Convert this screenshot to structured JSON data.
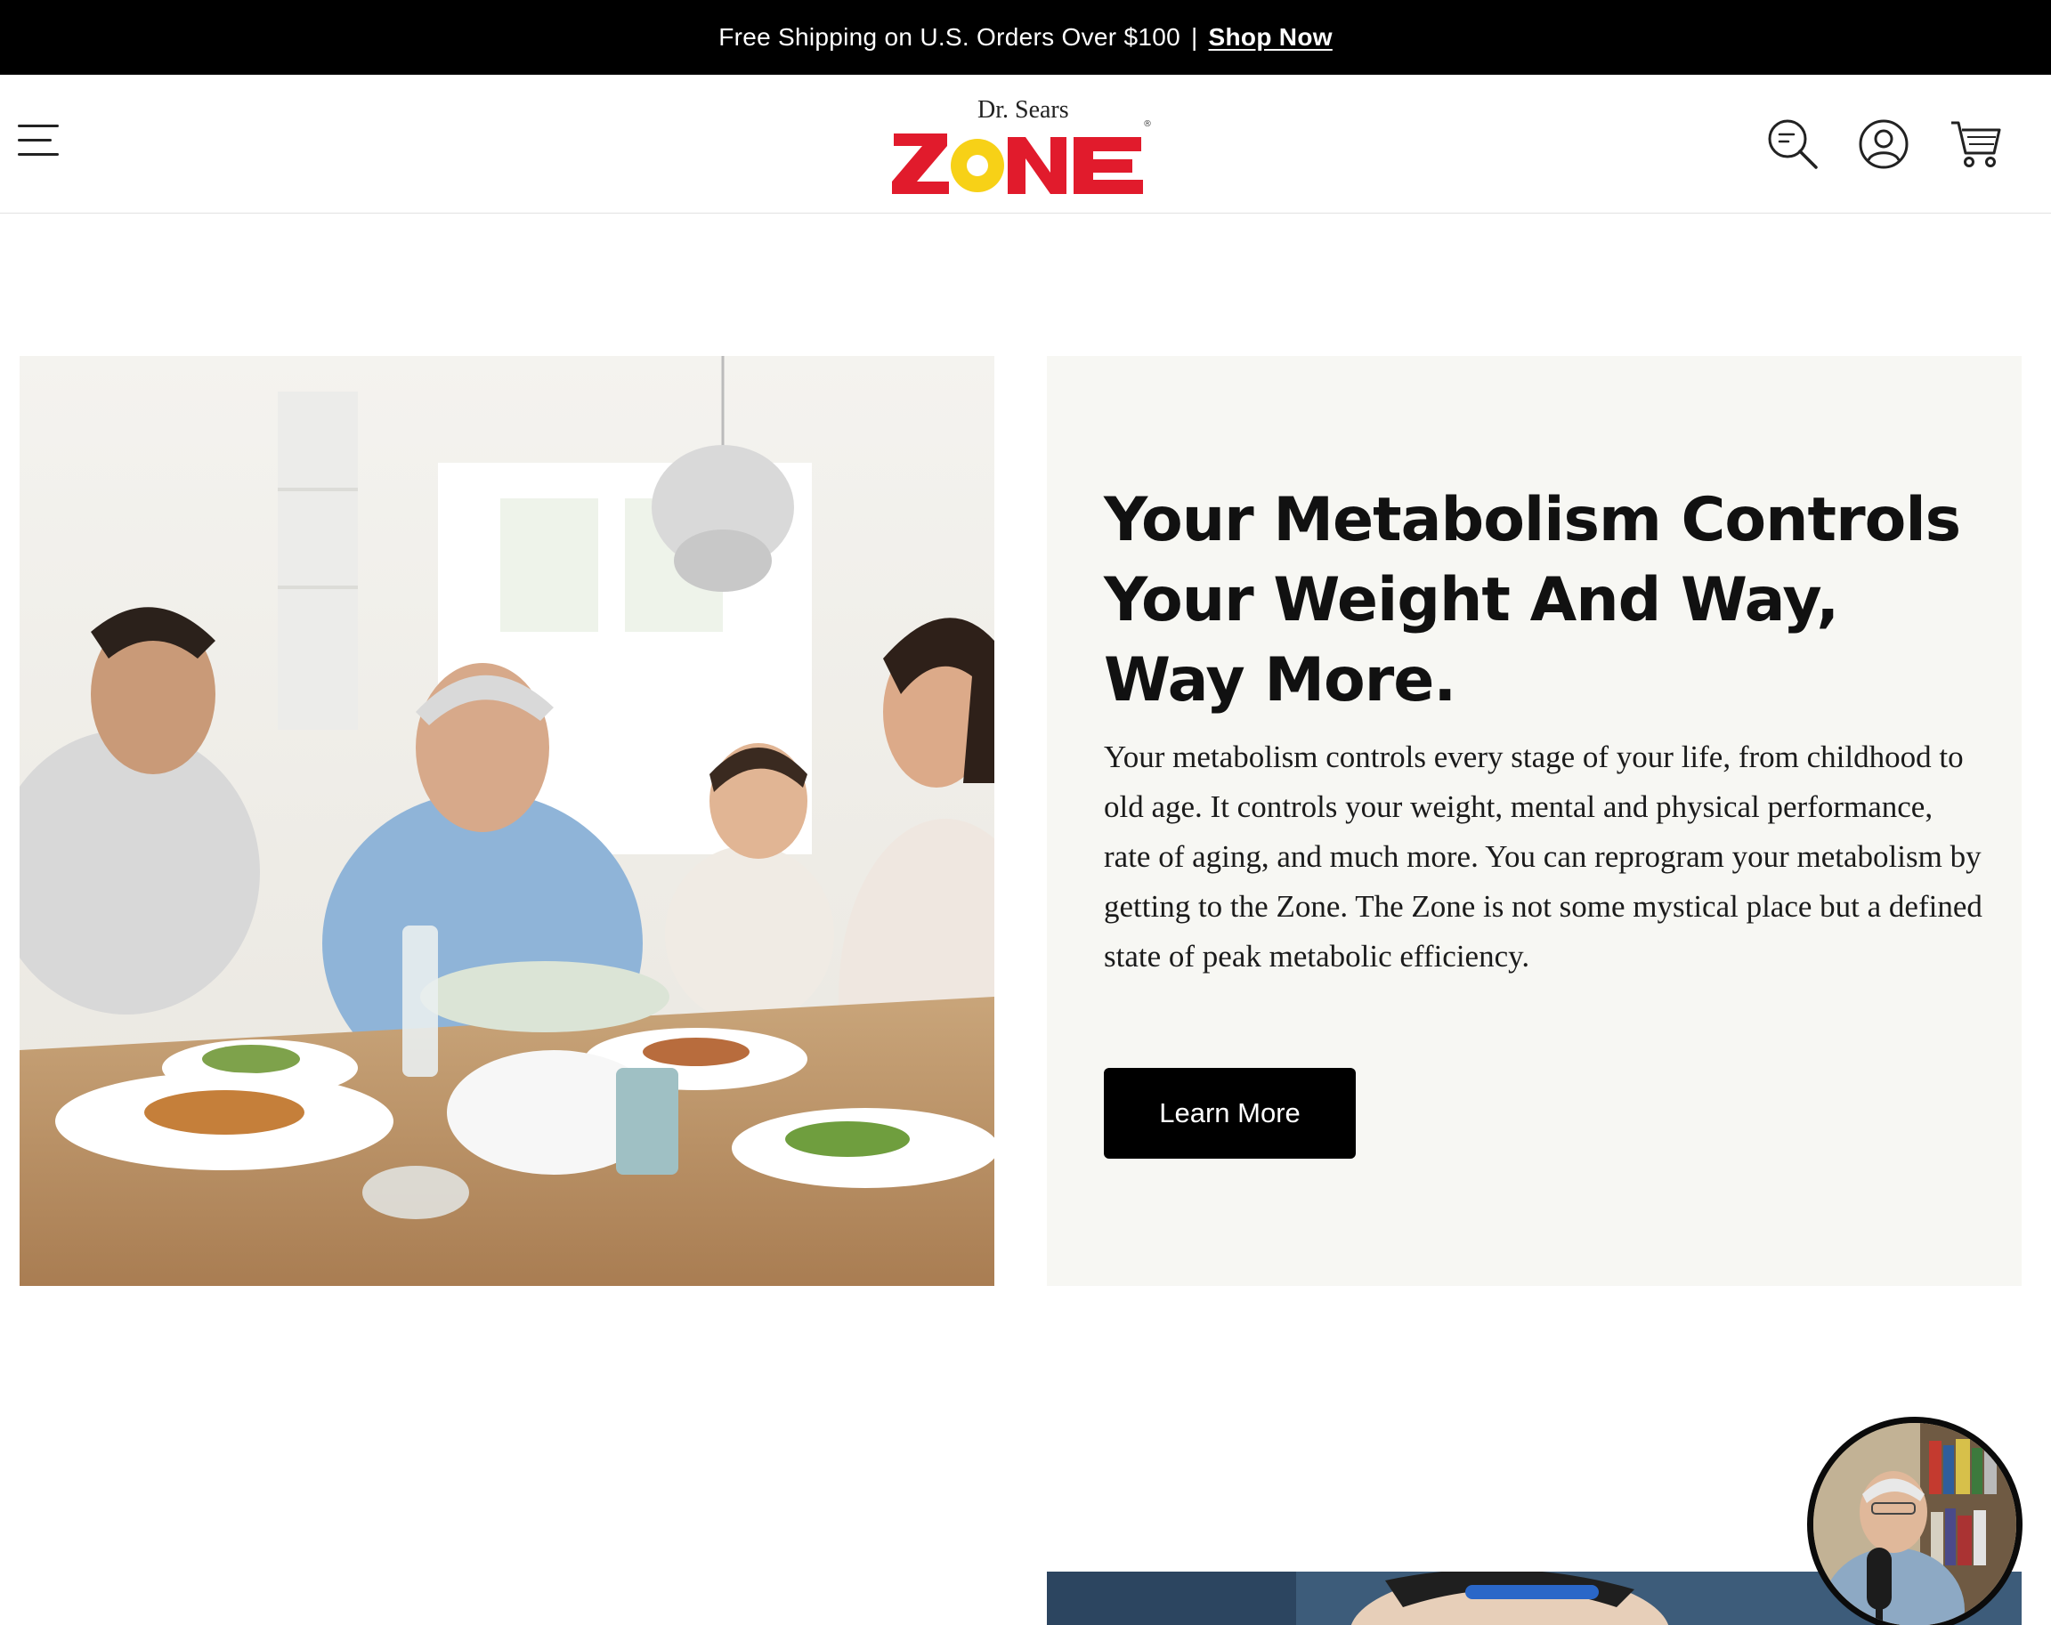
{
  "announcement": {
    "text": "Free Shipping on U.S. Orders Over $100",
    "separator": "|",
    "link_label": "Shop Now"
  },
  "header": {
    "menu_icon": "hamburger-menu-icon",
    "logo": {
      "prefix": "Dr. Sears",
      "wordmark": "ZONE",
      "registered": "®"
    },
    "icons": [
      "search-icon",
      "account-icon",
      "cart-icon"
    ]
  },
  "feature": {
    "image_alt": "Family sharing a meal at a dining table",
    "headline": "Your Metabolism Controls Your Weight And Way, Way More.",
    "body": "Your metabolism controls every stage of your life, from childhood to old age. It controls your weight, mental and physical performance, rate of aging, and much more. You can reprogram your metabolism by getting to the Zone. The Zone is not some mystical place but a defined state of peak metabolic efficiency.",
    "button_label": "Learn More"
  },
  "video_widget": {
    "icon": "video-avatar-icon"
  },
  "colors": {
    "brand_red": "#e11b2c",
    "brand_yellow": "#f7d117",
    "panel_bg": "#f7f7f3",
    "button_bg": "#000000"
  }
}
